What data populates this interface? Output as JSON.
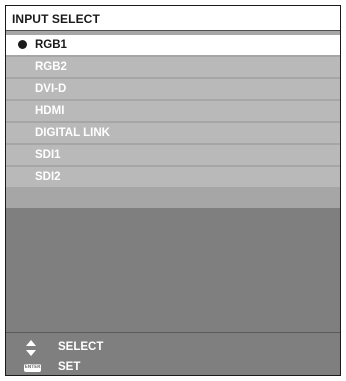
{
  "title": "INPUT SELECT",
  "inputs": [
    {
      "label": "RGB1",
      "selected": true
    },
    {
      "label": "RGB2",
      "selected": false
    },
    {
      "label": "DVI-D",
      "selected": false
    },
    {
      "label": "HDMI",
      "selected": false
    },
    {
      "label": "DIGITAL LINK",
      "selected": false
    },
    {
      "label": "SDI1",
      "selected": false
    },
    {
      "label": "SDI2",
      "selected": false
    }
  ],
  "footer": {
    "select": {
      "icon": "up-down-arrow-icon",
      "label": "SELECT"
    },
    "set": {
      "icon": "enter-icon",
      "icon_text": "ENTER",
      "label": "SET"
    }
  },
  "colors": {
    "panel_bg": "#a6a6a6",
    "item_bg": "#b9b9b9",
    "selected_bg": "#ffffff",
    "footer_bg": "#7f7f7f",
    "text_dark": "#1a1a1a",
    "text_light": "#ffffff"
  }
}
